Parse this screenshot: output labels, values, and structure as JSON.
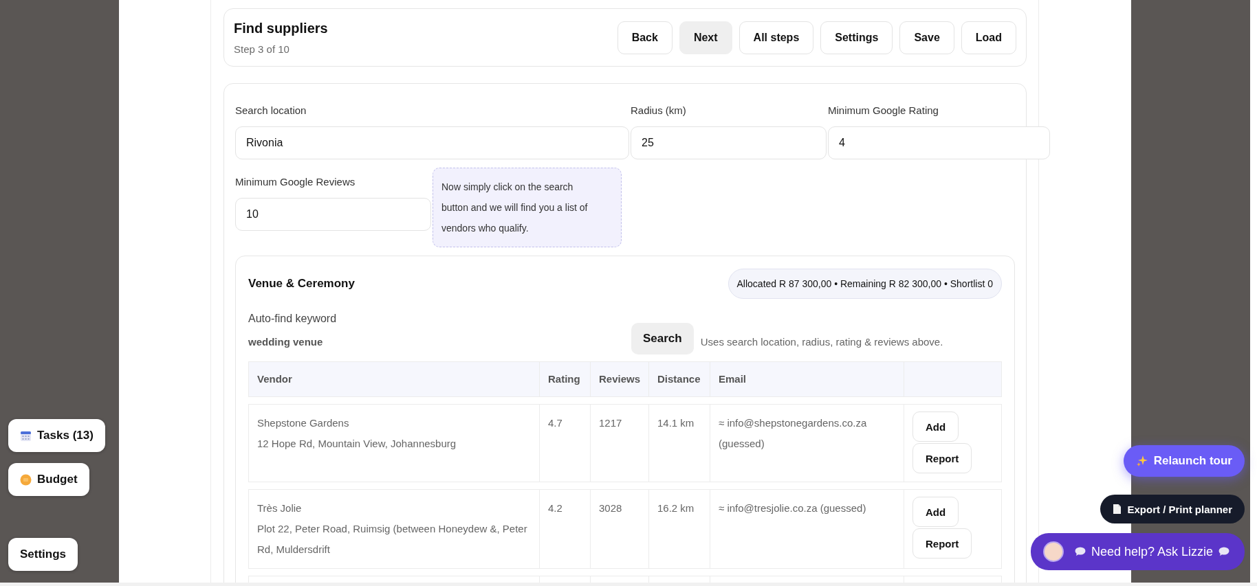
{
  "header": {
    "title": "Find suppliers",
    "subtitle": "Step 3 of 10",
    "buttons": [
      {
        "label": "Back",
        "highlighted": false
      },
      {
        "label": "Next",
        "highlighted": true
      },
      {
        "label": "All steps",
        "highlighted": false
      },
      {
        "label": "Settings",
        "highlighted": false
      },
      {
        "label": "Save",
        "highlighted": false
      },
      {
        "label": "Load",
        "highlighted": false
      }
    ]
  },
  "form": {
    "fields": [
      {
        "label": "Search location",
        "value": "Rivonia"
      },
      {
        "label": "Radius (km)",
        "value": "25"
      },
      {
        "label": "Minimum Google Rating",
        "value": "4"
      },
      {
        "label": "Minimum Google Reviews",
        "value": "10"
      }
    ],
    "tooltip": "Now simply click on the search button and we will find you a list of vendors who qualify."
  },
  "section": {
    "title": "Venue & Ceremony",
    "summary": "Allocated R 87 300,00 • Remaining R 82 300,00 • Shortlist 0",
    "keyword_label": "Auto-find keyword",
    "keyword": "wedding venue",
    "search_button": "Search",
    "search_hint": "Uses search location, radius, rating & reviews above.",
    "table": {
      "columns": [
        "Vendor",
        "Rating",
        "Reviews",
        "Distance",
        "Email"
      ],
      "rows": [
        {
          "name": "Shepstone Gardens",
          "address": "12 Hope Rd, Mountain View, Johannesburg",
          "rating": "4.7",
          "reviews": "1217",
          "distance": "14.1 km",
          "email": "≈ info@shepstonegardens.co.za (guessed)",
          "actions": [
            "Add",
            "Report"
          ]
        },
        {
          "name": "Très Jolie",
          "address": "Plot 22, Peter Road, Ruimsig (between Honeydew &, Peter Rd, Muldersdrift",
          "rating": "4.2",
          "reviews": "3028",
          "distance": "16.2 km",
          "email": "≈ info@tresjolie.co.za (guessed)",
          "actions": [
            "Add",
            "Report"
          ]
        }
      ]
    }
  },
  "side_buttons": [
    {
      "label": "Tasks (13)",
      "kind": "calendar"
    },
    {
      "label": "Budget",
      "kind": "coin"
    },
    {
      "label": "Settings",
      "kind": "plain"
    }
  ],
  "floating_buttons": [
    {
      "label": "Relaunch tour",
      "kind": "tour"
    },
    {
      "label": "Export / Print planner",
      "kind": "export"
    },
    {
      "label": "Need help? Ask Lizzie",
      "kind": "help"
    }
  ]
}
